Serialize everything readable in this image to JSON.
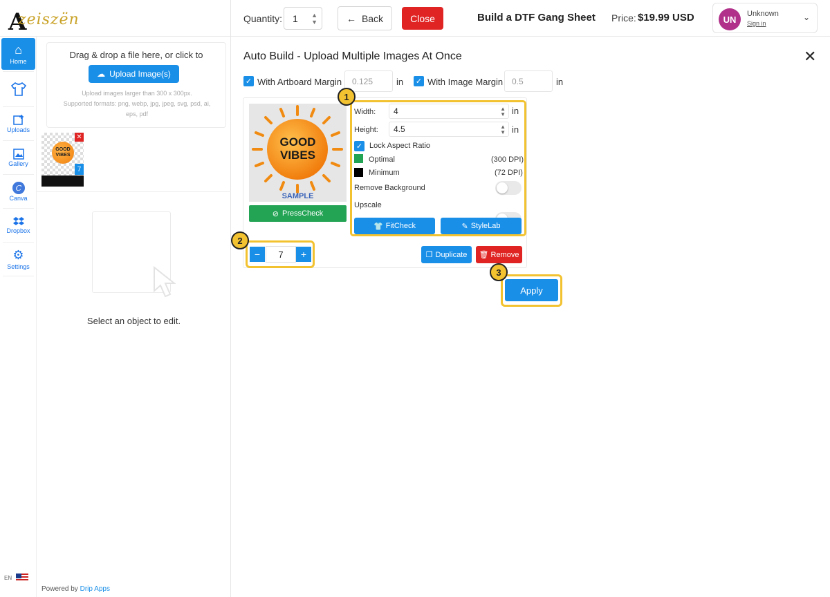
{
  "header": {
    "logo_text": "zeiszën",
    "quantity_label": "Quantity:",
    "quantity_value": "1",
    "back_label": "Back",
    "close_label": "Close",
    "title": "Build a DTF Gang Sheet",
    "price_label": "Price:",
    "price_value": "$19.99 USD",
    "user": {
      "initials": "UN",
      "name": "Unknown",
      "sign_in": "Sign in"
    }
  },
  "rail": {
    "items": [
      {
        "label": "Home",
        "icon": "home-icon"
      },
      {
        "label": "",
        "icon": "shirt-icon"
      },
      {
        "label": "Uploads",
        "icon": "upload-icon"
      },
      {
        "label": "Gallery",
        "icon": "gallery-icon"
      },
      {
        "label": "Canva",
        "icon": "canva-icon"
      },
      {
        "label": "Dropbox",
        "icon": "dropbox-icon"
      },
      {
        "label": "Settings",
        "icon": "gear-icon"
      }
    ],
    "lang": "EN"
  },
  "left": {
    "upload_title": "Drag & drop a file here, or click to",
    "upload_button": "Upload Image(s)",
    "upload_hint_1": "Upload images larger than 300 x 300px.",
    "upload_hint_2": "Supported formats: png, webp, jpg, jpeg, svg, psd, ai,",
    "upload_hint_3": "eps, pdf",
    "thumb_text": "GOOD VIBES",
    "thumb_count": "7",
    "select_text": "Select an object to edit.",
    "powered_prefix": "Powered by",
    "powered_link": "Drip Apps"
  },
  "main": {
    "title": "Auto Build - Upload Multiple Images At Once",
    "artboard_margin_label": "With Artboard Margin",
    "artboard_margin_value": "0.125",
    "image_margin_label": "With Image Margin",
    "image_margin_value": "0.5",
    "unit": "in",
    "preview": {
      "line1": "GOOD",
      "line2": "VIBES",
      "sample": "SAMPLE"
    },
    "presscheck": "PressCheck",
    "width_label": "Width:",
    "width_value": "4",
    "height_label": "Height:",
    "height_value": "4.5",
    "lock_label": "Lock Aspect Ratio",
    "optimal_label": "Optimal",
    "optimal_dpi": "(300 DPI)",
    "minimum_label": "Minimum",
    "minimum_dpi": "(72 DPI)",
    "remove_bg_label": "Remove Background",
    "upscale_label": "Upscale",
    "fitcheck": "FitCheck",
    "stylelab": "StyleLab",
    "count_value": "7",
    "duplicate": "Duplicate",
    "remove": "Remove",
    "apply": "Apply",
    "badges": [
      "1",
      "2",
      "3"
    ]
  },
  "colors": {
    "accent": "#1a8fe8",
    "danger": "#e02424",
    "success": "#23a455",
    "highlight": "#f2c230",
    "avatar": "#b0308a"
  }
}
